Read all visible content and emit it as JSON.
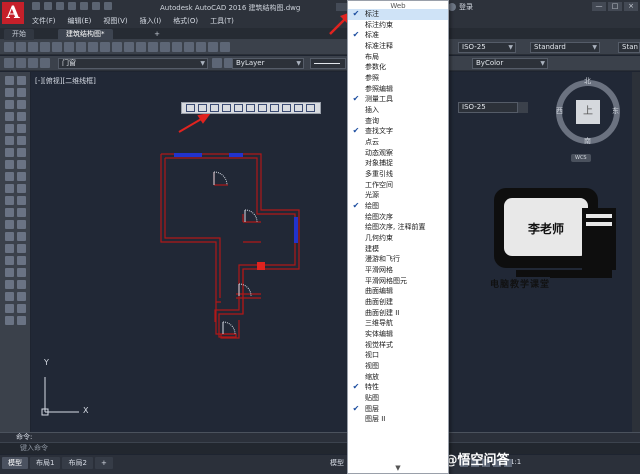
{
  "window": {
    "app_letter": "A",
    "title": "Autodesk AutoCAD 2016    建筑结构图.dwg",
    "login": "登录",
    "win_controls": [
      "—",
      "□",
      "×"
    ]
  },
  "menubar": [
    "文件(F)",
    "编辑(E)",
    "视图(V)",
    "插入(I)",
    "格式(O)",
    "工具(T)"
  ],
  "tabs": [
    "开始",
    "建筑结构图*"
  ],
  "tab_add": "+",
  "toolbar2": {
    "layer": "门窗",
    "color": "ByLayer",
    "plotstyle": "ByColor"
  },
  "canvas": {
    "view_label": "[-][俯视][二维线框]",
    "y_label": "Y",
    "x_label": "X"
  },
  "right_panel": {
    "dim_style_top": "ISO-25",
    "text_style": "Standard",
    "table_style_cut": "Stan",
    "dim_style_float": "ISO-25",
    "compass_n": "北",
    "compass_s": "南",
    "compass_e": "东",
    "compass_w": "西",
    "cube_face": "上",
    "wcs": "WCS"
  },
  "logo": {
    "name": "李老师",
    "caption": "电脑教学课堂"
  },
  "context_menu": {
    "top_label": "Web",
    "items": [
      {
        "label": "标注",
        "checked": true,
        "highlight": true
      },
      {
        "label": "标注约束",
        "checked": false
      },
      {
        "label": "标准",
        "checked": true
      },
      {
        "label": "标准注释",
        "checked": false
      },
      {
        "label": "布局",
        "checked": false
      },
      {
        "label": "参数化",
        "checked": false
      },
      {
        "label": "参照",
        "checked": false
      },
      {
        "label": "参照编辑",
        "checked": false
      },
      {
        "label": "测量工具",
        "checked": true
      },
      {
        "label": "插入",
        "checked": false
      },
      {
        "label": "查询",
        "checked": false
      },
      {
        "label": "查找文字",
        "checked": true
      },
      {
        "label": "点云",
        "checked": false
      },
      {
        "label": "动态观察",
        "checked": false
      },
      {
        "label": "对象捕捉",
        "checked": false
      },
      {
        "label": "多重引线",
        "checked": false
      },
      {
        "label": "工作空间",
        "checked": false
      },
      {
        "label": "光源",
        "checked": false
      },
      {
        "label": "绘图",
        "checked": true
      },
      {
        "label": "绘图次序",
        "checked": false
      },
      {
        "label": "绘图次序, 注释前置",
        "checked": false
      },
      {
        "label": "几何约束",
        "checked": false
      },
      {
        "label": "建模",
        "checked": false
      },
      {
        "label": "漫游和飞行",
        "checked": false
      },
      {
        "label": "平滑网格",
        "checked": false
      },
      {
        "label": "平滑网格图元",
        "checked": false
      },
      {
        "label": "曲面编辑",
        "checked": false
      },
      {
        "label": "曲面创建",
        "checked": false
      },
      {
        "label": "曲面创建 II",
        "checked": false
      },
      {
        "label": "三维导航",
        "checked": false
      },
      {
        "label": "实体编辑",
        "checked": false
      },
      {
        "label": "视觉样式",
        "checked": false
      },
      {
        "label": "视口",
        "checked": false
      },
      {
        "label": "视图",
        "checked": false
      },
      {
        "label": "缩放",
        "checked": false
      },
      {
        "label": "特性",
        "checked": true
      },
      {
        "label": "贴图",
        "checked": false
      },
      {
        "label": "图层",
        "checked": true
      },
      {
        "label": "图层 II",
        "checked": false
      }
    ],
    "scroll_down": "▼"
  },
  "command": {
    "label": "命令:",
    "placeholder": "键入命令"
  },
  "layout_tabs": [
    "模型",
    "布局1",
    "布局2",
    "+"
  ],
  "status": {
    "model": "模型",
    "scale": "1:1"
  },
  "brand": "头条 @悟空问答",
  "colors": {
    "wall": "#b01818",
    "window_fill": "#2233cc",
    "accent_red": "#e0231f",
    "check": "#1d4ea0"
  }
}
